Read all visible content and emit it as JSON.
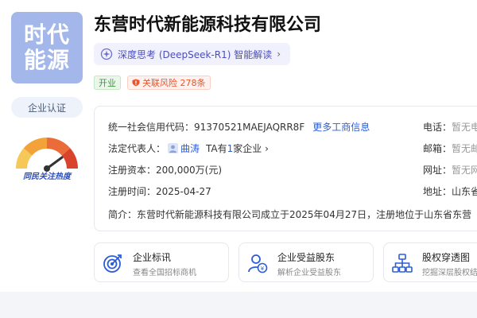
{
  "company": {
    "logo_line1": "时代",
    "logo_line2": "能源",
    "name": "东营时代新能源科技有限公司",
    "certification": "企业认证",
    "heat_label": "同民关注热度"
  },
  "ai_insight": {
    "label": "深度思考 (DeepSeek-R1) 智能解读",
    "icon": "sparkle-icon"
  },
  "tags": {
    "status": "开业",
    "risk": "关联风险 278条"
  },
  "info": {
    "credit_code_label": "统一社会信用代码：",
    "credit_code": "91370521MAEJAQRR8F",
    "more_info_link": "更多工商信息",
    "legal_rep_label": "法定代表人：",
    "legal_rep_name": "曲涛",
    "ta_prefix": "TA有",
    "ta_count": "1",
    "ta_suffix": "家企业 ›",
    "capital_label": "注册资本：",
    "capital_value": "200,000万(元)",
    "reg_date_label": "注册时间：",
    "reg_date_value": "2025-04-27",
    "intro_label": "简介：",
    "intro_text": "东营时代新能源科技有限公司成立于2025年04月27日，注册地位于山东省东营",
    "phone_label": "电话：",
    "phone_value": "暂无电",
    "email_label": "邮箱：",
    "email_value": "暂无邮",
    "website_label": "网址：",
    "website_value": "暂无网",
    "address_label": "地址：",
    "address_value": "山东省"
  },
  "features": [
    {
      "title": "企业标讯",
      "subtitle": "查看全国招标商机",
      "icon": "target-icon"
    },
    {
      "title": "企业受益股东",
      "subtitle": "解析企业受益股东",
      "icon": "user-money-icon"
    },
    {
      "title": "股权穿透图",
      "subtitle": "挖掘深层股权结",
      "icon": "org-chart-icon"
    }
  ],
  "colors": {
    "accent": "#2b5dd9",
    "logo_bg": "#a3b7ea",
    "status_green": "#3b9b3b",
    "risk_orange": "#e8552c"
  }
}
